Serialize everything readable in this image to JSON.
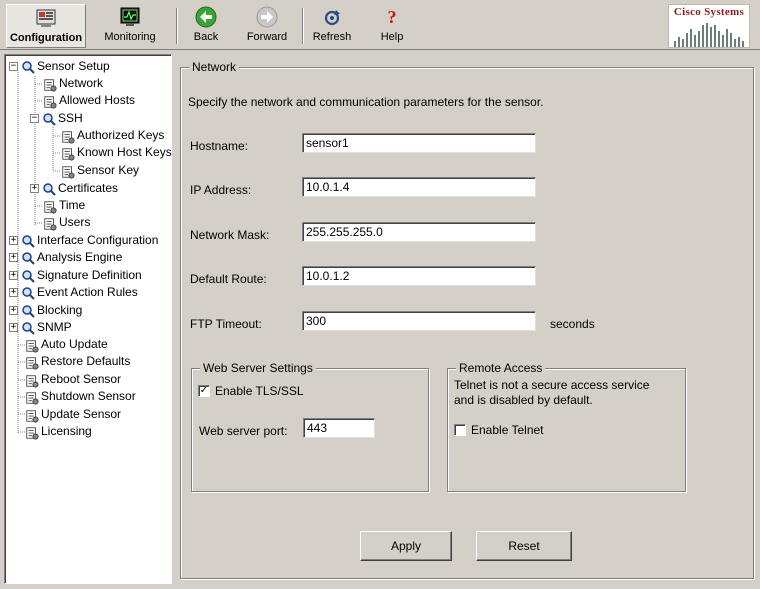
{
  "toolbar": {
    "configuration": "Configuration",
    "monitoring": "Monitoring",
    "back": "Back",
    "forward": "Forward",
    "refresh": "Refresh",
    "help": "Help",
    "logo": "Cisco Systems"
  },
  "tree": {
    "sensor_setup": "Sensor Setup",
    "network": "Network",
    "allowed_hosts": "Allowed Hosts",
    "ssh": "SSH",
    "authorized_keys": "Authorized Keys",
    "known_host_keys": "Known Host Keys",
    "sensor_key": "Sensor Key",
    "certificates": "Certificates",
    "time": "Time",
    "users": "Users",
    "interface_configuration": "Interface Configuration",
    "analysis_engine": "Analysis Engine",
    "signature_definition": "Signature Definition",
    "event_action_rules": "Event Action Rules",
    "blocking": "Blocking",
    "snmp": "SNMP",
    "auto_update": "Auto Update",
    "restore_defaults": "Restore Defaults",
    "reboot_sensor": "Reboot Sensor",
    "shutdown_sensor": "Shutdown Sensor",
    "update_sensor": "Update Sensor",
    "licensing": "Licensing"
  },
  "network": {
    "group_title": "Network",
    "description": "Specify the network and communication parameters for the sensor.",
    "hostname_label": "Hostname:",
    "hostname_value": "sensor1",
    "ip_label": "IP Address:",
    "ip_value": "10.0.1.4",
    "mask_label": "Network Mask:",
    "mask_value": "255.255.255.0",
    "route_label": "Default Route:",
    "route_value": "10.0.1.2",
    "ftp_label": "FTP Timeout:",
    "ftp_value": "300",
    "ftp_unit": "seconds"
  },
  "web_server": {
    "title": "Web Server Settings",
    "tls_label": "Enable TLS/SSL",
    "tls_checked": true,
    "port_label": "Web server port:",
    "port_value": "443"
  },
  "remote_access": {
    "title": "Remote Access",
    "note_line1": "Telnet is not a secure access service",
    "note_line2": "and is disabled by default.",
    "telnet_label": "Enable Telnet",
    "telnet_checked": false
  },
  "buttons": {
    "apply": "Apply",
    "reset": "Reset"
  }
}
